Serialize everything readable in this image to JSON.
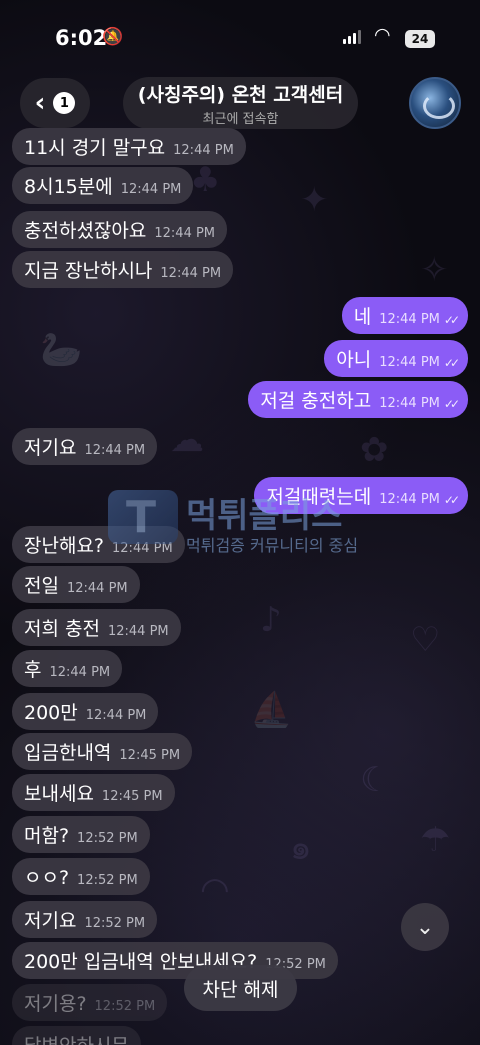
{
  "status_bar": {
    "time": "6:02",
    "battery": "24"
  },
  "header": {
    "back_count": "1",
    "title": "(사칭주의) 온천 고객센터",
    "subtitle": "최근에 접속함"
  },
  "messages": [
    {
      "dir": "in",
      "text": "11시 경기 말구요",
      "time": "12:44 PM"
    },
    {
      "dir": "in",
      "text": "8시15분에",
      "time": "12:44 PM"
    },
    {
      "dir": "in",
      "text": "충전하셨잖아요",
      "time": "12:44 PM"
    },
    {
      "dir": "in",
      "text": "지금 장난하시나",
      "time": "12:44 PM"
    },
    {
      "dir": "out",
      "text": "네",
      "time": "12:44 PM"
    },
    {
      "dir": "out",
      "text": "아니",
      "time": "12:44 PM"
    },
    {
      "dir": "out",
      "text": "저걸 충전하고",
      "time": "12:44 PM"
    },
    {
      "dir": "in",
      "text": "저기요",
      "time": "12:44 PM"
    },
    {
      "dir": "out",
      "text": "저걸때렷는데",
      "time": "12:44 PM"
    },
    {
      "dir": "in",
      "text": "장난해요?",
      "time": "12:44 PM"
    },
    {
      "dir": "in",
      "text": "전일",
      "time": "12:44 PM"
    },
    {
      "dir": "in",
      "text": "저희 충전",
      "time": "12:44 PM"
    },
    {
      "dir": "in",
      "text": "후",
      "time": "12:44 PM"
    },
    {
      "dir": "in",
      "text": "200만",
      "time": "12:44 PM"
    },
    {
      "dir": "in",
      "text": "입금한내역",
      "time": "12:45 PM"
    },
    {
      "dir": "in",
      "text": "보내세요",
      "time": "12:45 PM"
    },
    {
      "dir": "in",
      "text": "머함?",
      "time": "12:52 PM"
    },
    {
      "dir": "in",
      "text": "ㅇㅇ?",
      "time": "12:52 PM"
    },
    {
      "dir": "in",
      "text": "저기요",
      "time": "12:52 PM"
    },
    {
      "dir": "in",
      "text": "200만 입금내역 안보내세요?",
      "time": "12:52 PM"
    },
    {
      "dir": "in",
      "text": "저기용?",
      "time": "12:52 PM"
    },
    {
      "dir": "in",
      "text": "답변안하시뮤",
      "time": ""
    }
  ],
  "watermark": {
    "brand": "먹튀폴리스",
    "tagline": "먹튀검증 커뮤니티의 중심"
  },
  "unblock_label": "차단 해제",
  "colors": {
    "outgoing_bubble": "#8b5cf6",
    "incoming_bubble": "#3a3742"
  }
}
